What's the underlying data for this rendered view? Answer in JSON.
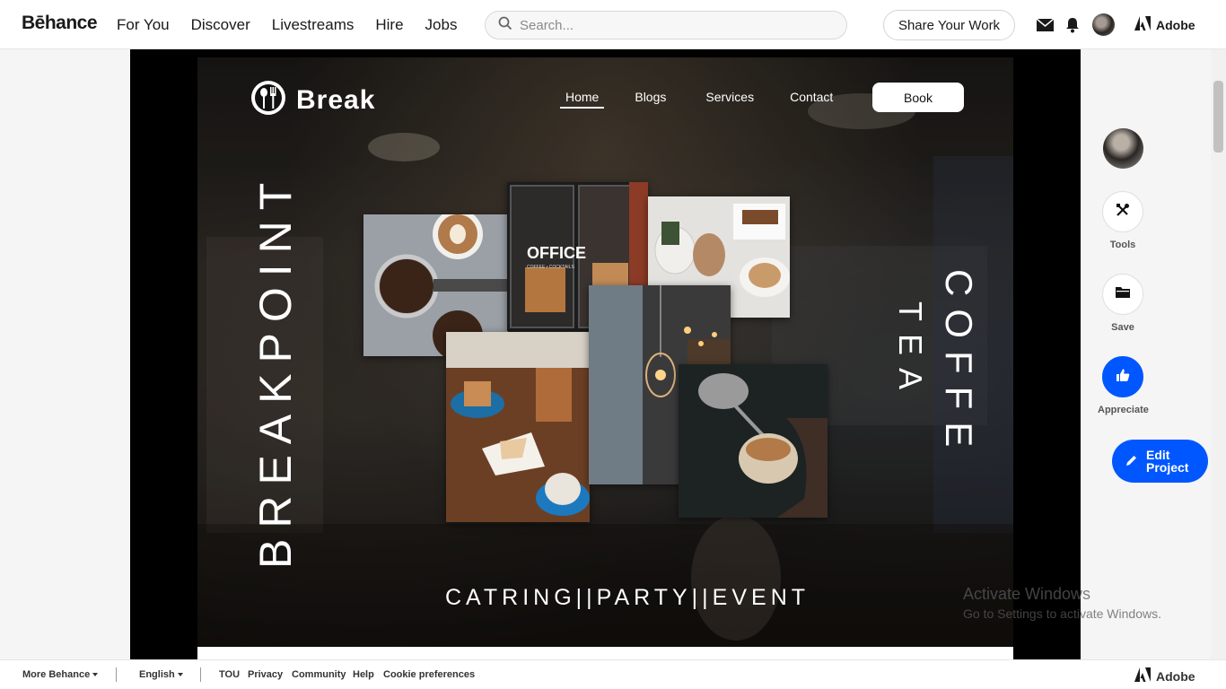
{
  "header": {
    "logo": "Bēhance",
    "nav": [
      "For You",
      "Discover",
      "Livestreams",
      "Hire",
      "Jobs"
    ],
    "search_placeholder": "Search...",
    "share_label": "Share Your Work",
    "adobe_label": "Adobe"
  },
  "hero": {
    "brand": "Break",
    "nav": [
      "Home",
      "Blogs",
      "Services",
      "Contact"
    ],
    "book": "Book",
    "vertical_left": "BREAKPOINT",
    "vertical_right_1": "COFFE",
    "vertical_right_2": "TEA",
    "tagline": "CATRING||PARTY||EVENT",
    "office_sign": "OFFICE",
    "office_sub": "COFFEE • COCKTAILS"
  },
  "sidebar": {
    "tools": "Tools",
    "save": "Save",
    "appreciate": "Appreciate",
    "edit_line1": "Edit",
    "edit_line2": "Project"
  },
  "watermark": {
    "title": "Activate Windows",
    "subtitle": "Go to Settings to activate Windows."
  },
  "footer": {
    "more": "More Behance",
    "language": "English",
    "links": [
      "TOU",
      "Privacy",
      "Community",
      "Help",
      "Cookie preferences"
    ],
    "adobe": "Adobe"
  },
  "colors": {
    "accent": "#0057ff",
    "stage": "#000000"
  }
}
